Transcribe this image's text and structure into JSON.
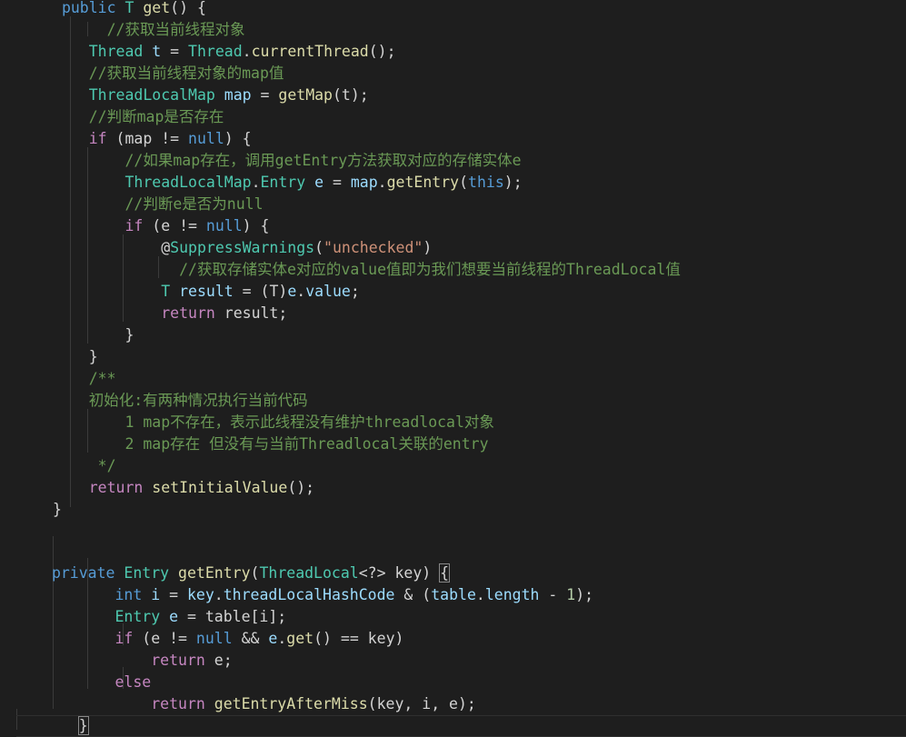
{
  "theme": {
    "background": "#1e1e1e",
    "keyword": "#569cd6",
    "control": "#c586c0",
    "type": "#4ec9b0",
    "function": "#dcdcaa",
    "variable": "#9cdcfe",
    "comment": "#6a9955",
    "string": "#ce9178",
    "number": "#b5cea8",
    "text": "#d4d4d4"
  },
  "code": {
    "lines": [
      {
        "tokens": [
          {
            "t": " "
          },
          {
            "t": "public",
            "c": "kw"
          },
          {
            "t": " "
          },
          {
            "t": "T",
            "c": "type"
          },
          {
            "t": " "
          },
          {
            "t": "get",
            "c": "fn"
          },
          {
            "t": "() {"
          }
        ]
      },
      {
        "tokens": [
          {
            "t": "      "
          },
          {
            "t": "//获取当前线程对象",
            "c": "cm"
          }
        ]
      },
      {
        "tokens": [
          {
            "t": "    "
          },
          {
            "t": "Thread",
            "c": "type"
          },
          {
            "t": " "
          },
          {
            "t": "t",
            "c": "var"
          },
          {
            "t": " = "
          },
          {
            "t": "Thread",
            "c": "type"
          },
          {
            "t": "."
          },
          {
            "t": "currentThread",
            "c": "fn"
          },
          {
            "t": "();"
          }
        ]
      },
      {
        "tokens": [
          {
            "t": "    "
          },
          {
            "t": "//获取当前线程对象的map值",
            "c": "cm"
          }
        ]
      },
      {
        "tokens": [
          {
            "t": "    "
          },
          {
            "t": "ThreadLocalMap",
            "c": "type"
          },
          {
            "t": " "
          },
          {
            "t": "map",
            "c": "var"
          },
          {
            "t": " = "
          },
          {
            "t": "getMap",
            "c": "fn"
          },
          {
            "t": "(t);"
          }
        ]
      },
      {
        "tokens": [
          {
            "t": "    "
          },
          {
            "t": "//判断map是否存在",
            "c": "cm"
          }
        ]
      },
      {
        "tokens": [
          {
            "t": "    "
          },
          {
            "t": "if",
            "c": "ctl"
          },
          {
            "t": " (map != "
          },
          {
            "t": "null",
            "c": "kw"
          },
          {
            "t": ") {"
          }
        ]
      },
      {
        "tokens": [
          {
            "t": "        "
          },
          {
            "t": "//如果map存在，调用getEntry方法获取对应的存储实体e",
            "c": "cm"
          }
        ]
      },
      {
        "tokens": [
          {
            "t": "        "
          },
          {
            "t": "ThreadLocalMap",
            "c": "type"
          },
          {
            "t": "."
          },
          {
            "t": "Entry",
            "c": "type"
          },
          {
            "t": " "
          },
          {
            "t": "e",
            "c": "var"
          },
          {
            "t": " = "
          },
          {
            "t": "map",
            "c": "var"
          },
          {
            "t": "."
          },
          {
            "t": "getEntry",
            "c": "fn"
          },
          {
            "t": "("
          },
          {
            "t": "this",
            "c": "kw"
          },
          {
            "t": ");"
          }
        ]
      },
      {
        "tokens": [
          {
            "t": "        "
          },
          {
            "t": "//判断e是否为null",
            "c": "cm"
          }
        ]
      },
      {
        "tokens": [
          {
            "t": "        "
          },
          {
            "t": "if",
            "c": "ctl"
          },
          {
            "t": " (e != "
          },
          {
            "t": "null",
            "c": "kw"
          },
          {
            "t": ") {"
          }
        ]
      },
      {
        "tokens": [
          {
            "t": "            "
          },
          {
            "t": "@",
            "c": "ann"
          },
          {
            "t": "SuppressWarnings",
            "c": "type"
          },
          {
            "t": "("
          },
          {
            "t": "\"unchecked\"",
            "c": "str"
          },
          {
            "t": ")"
          }
        ]
      },
      {
        "tokens": [
          {
            "t": "              "
          },
          {
            "t": "//获取存储实体e对应的value值即为我们想要当前线程的ThreadLocal值",
            "c": "cm"
          }
        ]
      },
      {
        "tokens": [
          {
            "t": "            "
          },
          {
            "t": "T",
            "c": "type"
          },
          {
            "t": " "
          },
          {
            "t": "result",
            "c": "var"
          },
          {
            "t": " = (T)"
          },
          {
            "t": "e",
            "c": "var"
          },
          {
            "t": "."
          },
          {
            "t": "value",
            "c": "var"
          },
          {
            "t": ";"
          }
        ]
      },
      {
        "tokens": [
          {
            "t": "            "
          },
          {
            "t": "return",
            "c": "ctl"
          },
          {
            "t": " result;"
          }
        ]
      },
      {
        "tokens": [
          {
            "t": "        }"
          }
        ]
      },
      {
        "tokens": [
          {
            "t": "    }"
          }
        ]
      },
      {
        "tokens": [
          {
            "t": "    "
          },
          {
            "t": "/**",
            "c": "cm"
          }
        ]
      },
      {
        "tokens": [
          {
            "t": "    "
          },
          {
            "t": "初始化:有两种情况执行当前代码",
            "c": "cm"
          }
        ]
      },
      {
        "tokens": [
          {
            "t": "        "
          },
          {
            "t": "1 map不存在，表示此线程没有维护threadlocal对象",
            "c": "cm"
          }
        ]
      },
      {
        "tokens": [
          {
            "t": "        "
          },
          {
            "t": "2 map存在 但没有与当前Threadlocal关联的entry",
            "c": "cm"
          }
        ]
      },
      {
        "tokens": [
          {
            "t": "     "
          },
          {
            "t": "*/",
            "c": "cm"
          }
        ]
      },
      {
        "tokens": [
          {
            "t": "    "
          },
          {
            "t": "return",
            "c": "ctl"
          },
          {
            "t": " "
          },
          {
            "t": "setInitialValue",
            "c": "fn"
          },
          {
            "t": "();"
          }
        ]
      },
      {
        "tokens": [
          {
            "t": "}"
          }
        ]
      },
      {
        "tokens": []
      },
      {
        "tokens": [
          {
            "t": " "
          },
          {
            "t": "private",
            "c": "kw"
          },
          {
            "t": " "
          },
          {
            "t": "Entry",
            "c": "type"
          },
          {
            "t": " "
          },
          {
            "t": "getEntry",
            "c": "fn"
          },
          {
            "t": "("
          },
          {
            "t": "ThreadLocal",
            "c": "type"
          },
          {
            "t": "<?> key) "
          },
          {
            "t": "{",
            "c": "bracket"
          }
        ]
      },
      {
        "tokens": [
          {
            "t": "        "
          },
          {
            "t": "int",
            "c": "kw"
          },
          {
            "t": " "
          },
          {
            "t": "i",
            "c": "var"
          },
          {
            "t": " = "
          },
          {
            "t": "key",
            "c": "var"
          },
          {
            "t": "."
          },
          {
            "t": "threadLocalHashCode",
            "c": "var"
          },
          {
            "t": " & ("
          },
          {
            "t": "table",
            "c": "var"
          },
          {
            "t": "."
          },
          {
            "t": "length",
            "c": "var"
          },
          {
            "t": " - "
          },
          {
            "t": "1",
            "c": "num"
          },
          {
            "t": ");"
          }
        ]
      },
      {
        "tokens": [
          {
            "t": "        "
          },
          {
            "t": "Entry",
            "c": "type"
          },
          {
            "t": " "
          },
          {
            "t": "e",
            "c": "var"
          },
          {
            "t": " = table[i];"
          }
        ]
      },
      {
        "tokens": [
          {
            "t": "        "
          },
          {
            "t": "if",
            "c": "ctl"
          },
          {
            "t": " (e != "
          },
          {
            "t": "null",
            "c": "kw"
          },
          {
            "t": " && "
          },
          {
            "t": "e",
            "c": "var"
          },
          {
            "t": "."
          },
          {
            "t": "get",
            "c": "fn"
          },
          {
            "t": "() == key)"
          }
        ]
      },
      {
        "tokens": [
          {
            "t": "            "
          },
          {
            "t": "return",
            "c": "ctl"
          },
          {
            "t": " e;"
          }
        ]
      },
      {
        "tokens": [
          {
            "t": "        "
          },
          {
            "t": "else",
            "c": "ctl"
          }
        ]
      },
      {
        "tokens": [
          {
            "t": "            "
          },
          {
            "t": "return",
            "c": "ctl"
          },
          {
            "t": " "
          },
          {
            "t": "getEntryAfterMiss",
            "c": "fn"
          },
          {
            "t": "(key, i, e);"
          }
        ]
      },
      {
        "tokens": [
          {
            "t": "    "
          },
          {
            "t": "}",
            "c": "bracket"
          }
        ]
      }
    ]
  }
}
